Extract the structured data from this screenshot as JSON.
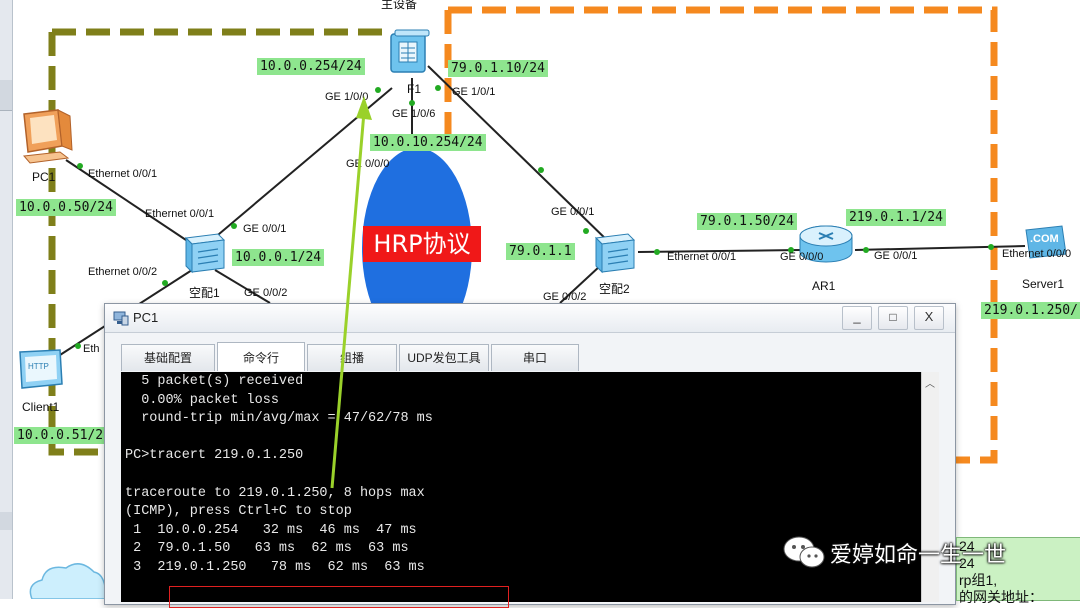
{
  "diagram": {
    "device_top_label": "主设备",
    "labels": {
      "ip_fw_left": "10.0.0.254/24",
      "ip_fw_right": "79.0.1.10/24",
      "ip_fw_mid": "10.0.10.254/24",
      "ip_pc1": "10.0.0.50/24",
      "ip_sw1": "10.0.0.1/24",
      "ip_client1": "10.0.0.51/2",
      "ip_sw2": "79.0.1.1",
      "ip_ar1_left": "79.0.1.50/24",
      "ip_ar1_right": "219.0.1.1/24",
      "ip_server1": "219.0.1.250/",
      "port_fw_ge100": "GE 1/0/0",
      "port_fw_ge101": "GE 1/0/1",
      "port_fw_ge106": "GE 1/0/6",
      "port_ge000_mid": "GE 0/0/0",
      "port_pc1_eth": "Ethernet 0/0/1",
      "port_sw1_eth001": "Ethernet 0/0/1",
      "port_sw1_eth002": "Ethernet 0/0/2",
      "port_sw1_ge001": "GE 0/0/1",
      "port_sw1_ge002": "GE 0/0/2",
      "port_client1_eth": "Eth",
      "port_sw2_ge001": "GE 0/0/1",
      "port_sw2_ge002": "GE 0/0/2",
      "port_sw2_eth": "Ethernet 0/0/1",
      "port_ar1_ge000": "GE 0/0/0",
      "port_ar1_ge001": "GE 0/0/1",
      "port_server1_eth": "Ethernet 0/0/0"
    },
    "devices": {
      "fw": "F1",
      "pc1": "PC1",
      "sw1": "空配1",
      "sw2": "空配2",
      "ar1": "AR1",
      "server1": "Server1",
      "client1": "Client1",
      "server_badge": ".COM",
      "client_badge": "HTTP"
    },
    "hrp_label": "HRP协议"
  },
  "window": {
    "title": "PC1",
    "btn_min": "_",
    "btn_max": "□",
    "btn_close": "X",
    "tabs": [
      "基础配置",
      "命令行",
      "组播",
      "UDP发包工具",
      "串口"
    ],
    "active_tab": 1,
    "terminal": [
      "  5 packet(s) received",
      "  0.00% packet loss",
      "  round-trip min/avg/max = 47/62/78 ms",
      "",
      "PC>tracert 219.0.1.250",
      "",
      "traceroute to 219.0.1.250, 8 hops max",
      "(ICMP), press Ctrl+C to stop",
      " 1  10.0.0.254   32 ms  46 ms  47 ms",
      " 2  79.0.1.50   63 ms  62 ms  63 ms",
      " 3  219.0.1.250   78 ms  62 ms  63 ms"
    ]
  },
  "watermark": "爱婷如命一生一世",
  "note": [
    "24",
    "24",
    "rp组1,",
    "的网关地址："
  ],
  "colors": {
    "green_frame": "#7f7f1a",
    "orange_frame": "#f5891f",
    "ip_bg": "#8ee58e",
    "hrp_blue": "#1f6fe0",
    "hrp_red": "#f01818",
    "arrow": "#9ad12a",
    "highlight": "#e02020"
  }
}
